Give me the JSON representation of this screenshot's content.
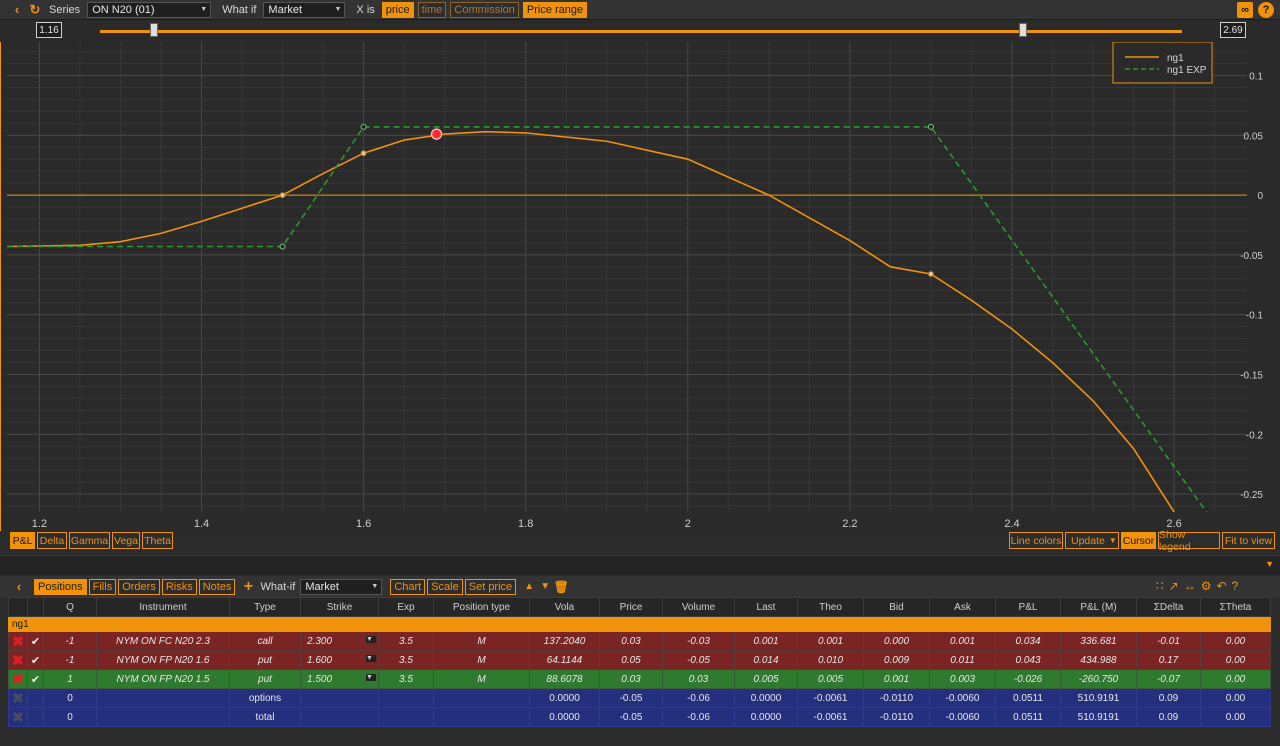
{
  "toolbar": {
    "series_label": "Series",
    "series_value": "ON N20 (01)",
    "whatif_label": "What if",
    "whatif_value": "Market",
    "xis_label": "X is",
    "x_buttons": [
      "price",
      "time",
      "Commission",
      "Price range"
    ]
  },
  "slider": {
    "min_label": "1.16",
    "max_label": "2.69",
    "left_fraction": 0.05,
    "right_fraction": 0.853
  },
  "chart_data": {
    "type": "line",
    "legend": [
      "ng1",
      "ng1 EXP"
    ],
    "legend_position": "top-right",
    "x_ticks": [
      "1.2",
      "1.4",
      "1.6",
      "1.8",
      "2",
      "2.2",
      "2.4",
      "2.6"
    ],
    "y_ticks": [
      "0.1",
      "0.05",
      "0",
      "-0.05",
      "-0.1",
      "-0.15",
      "-0.2",
      "-0.25"
    ],
    "xlim": [
      1.16,
      2.69
    ],
    "ylim": [
      -0.265,
      0.128
    ],
    "series": [
      {
        "name": "ng1",
        "color": "#f0920a",
        "style": "solid",
        "x": [
          1.16,
          1.25,
          1.3,
          1.35,
          1.4,
          1.45,
          1.5,
          1.55,
          1.6,
          1.65,
          1.7,
          1.75,
          1.8,
          1.9,
          2.0,
          2.1,
          2.2,
          2.25,
          2.3,
          2.35,
          2.4,
          2.45,
          2.5,
          2.55,
          2.6
        ],
        "y": [
          -0.043,
          -0.042,
          -0.039,
          -0.032,
          -0.022,
          -0.011,
          0.0,
          0.018,
          0.035,
          0.046,
          0.051,
          0.053,
          0.052,
          0.045,
          0.03,
          0.0,
          -0.038,
          -0.06,
          -0.066,
          -0.088,
          -0.112,
          -0.14,
          -0.172,
          -0.212,
          -0.265
        ],
        "markers_x": [
          1.5,
          1.6,
          2.3
        ],
        "markers_y": [
          0.0,
          0.035,
          -0.066
        ]
      },
      {
        "name": "ng1 EXP",
        "color": "#2a9a2a",
        "style": "dashed",
        "x": [
          1.16,
          1.5,
          1.6,
          2.3,
          2.64
        ],
        "y": [
          -0.043,
          -0.043,
          0.057,
          0.057,
          -0.265
        ],
        "markers_x": [
          1.5,
          1.6,
          2.3
        ],
        "markers_y": [
          -0.043,
          0.057,
          0.057
        ]
      }
    ],
    "highlight_point": {
      "x": 1.69,
      "y": 0.051
    }
  },
  "chart_tabs": [
    "P&L",
    "Delta",
    "Gamma",
    "Vega",
    "Theta"
  ],
  "chart_right_buttons": [
    "Line colors",
    "Update",
    "Cursor",
    "Show legend",
    "Fit to view"
  ],
  "positions_toolbar": {
    "tabs": [
      "Positions",
      "Fills",
      "Orders",
      "Risks",
      "Notes"
    ],
    "whatif_label": "What-if",
    "whatif_value": "Market",
    "buttons": [
      "Chart",
      "Scale",
      "Set price"
    ]
  },
  "table": {
    "columns": [
      "",
      "",
      "Q",
      "Instrument",
      "Type",
      "Strike",
      "Exp",
      "Position type",
      "Vola",
      "Price",
      "Volume",
      "Last",
      "Theo",
      "Bid",
      "Ask",
      "P&L",
      "P&L (M)",
      "ΣDelta",
      "ΣTheta"
    ],
    "group_label": "ng1",
    "rows": [
      {
        "kind": "red",
        "q": "-1",
        "instrument": "NYM ON FC N20 2.3",
        "type": "call",
        "strike": "2.300",
        "exp": "3.5",
        "pos_type": "M",
        "vola": "137.2040",
        "price": "0.03",
        "volume": "-0.03",
        "last": "0.001",
        "theo": "0.001",
        "bid": "0.000",
        "ask": "0.001",
        "pnl": "0.034",
        "pnl_m": "336.681",
        "sdelta": "-0.01",
        "stheta": "0.00"
      },
      {
        "kind": "red",
        "q": "-1",
        "instrument": "NYM ON FP N20 1.6",
        "type": "put",
        "strike": "1.600",
        "exp": "3.5",
        "pos_type": "M",
        "vola": "64.1144",
        "price": "0.05",
        "volume": "-0.05",
        "last": "0.014",
        "theo": "0.010",
        "bid": "0.009",
        "ask": "0.011",
        "pnl": "0.043",
        "pnl_m": "434.988",
        "sdelta": "0.17",
        "stheta": "0.00"
      },
      {
        "kind": "green",
        "q": "1",
        "instrument": "NYM ON FP N20 1.5",
        "type": "put",
        "strike": "1.500",
        "exp": "3.5",
        "pos_type": "M",
        "vola": "88.6078",
        "price": "0.03",
        "volume": "0.03",
        "last": "0.005",
        "theo": "0.005",
        "bid": "0.001",
        "ask": "0.003",
        "pnl": "-0.026",
        "pnl_m": "-260.750",
        "sdelta": "-0.07",
        "stheta": "0.00"
      },
      {
        "kind": "blue",
        "q": "0",
        "instrument": "",
        "type": "options",
        "strike": "",
        "exp": "",
        "pos_type": "",
        "vola": "0.0000",
        "price": "-0.05",
        "volume": "-0.06",
        "last": "0.0000",
        "theo": "-0.0061",
        "bid": "-0.0110",
        "ask": "-0.0060",
        "pnl": "0.0511",
        "pnl_m": "510.9191",
        "sdelta": "0.09",
        "stheta": "0.00"
      },
      {
        "kind": "blue",
        "q": "0",
        "instrument": "",
        "type": "total",
        "strike": "",
        "exp": "",
        "pos_type": "",
        "vola": "0.0000",
        "price": "-0.05",
        "volume": "-0.06",
        "last": "0.0000",
        "theo": "-0.0061",
        "bid": "-0.0110",
        "ask": "-0.0060",
        "pnl": "0.0511",
        "pnl_m": "510.9191",
        "sdelta": "0.09",
        "stheta": "0.00"
      }
    ]
  }
}
